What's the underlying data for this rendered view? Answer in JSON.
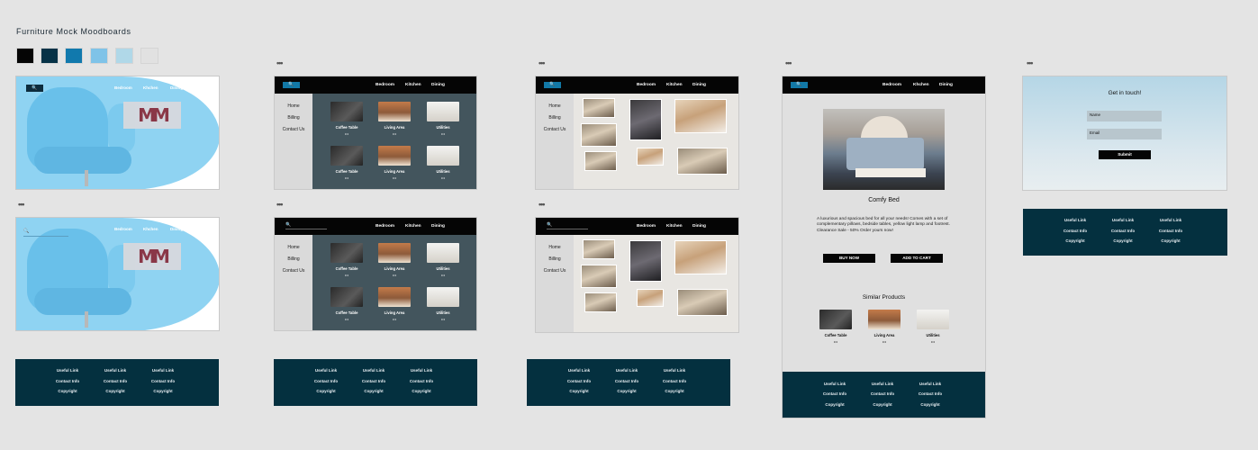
{
  "board_title": "Furniture Mock Moodboards",
  "palette": [
    "#050505",
    "#063247",
    "#1179ad",
    "#7fc3e8",
    "#b0d8e8",
    "#e1e1e1"
  ],
  "dots": "•••",
  "nav": {
    "search": "🔍",
    "bedroom": "Bedroom",
    "kitchen": "Khchen",
    "kitchen_alt": "Kitchen",
    "dining": "Dining"
  },
  "sidebar": {
    "home": "Home",
    "billing": "Billing",
    "contact": "Contact Us"
  },
  "tiles": {
    "coffee": "Coffee Table",
    "living": "Living Area",
    "utilities": "Utilities",
    "dots": "•••"
  },
  "footer": {
    "useful": "Useful Link",
    "contact": "Contact Info",
    "copyright": "Copyright"
  },
  "product": {
    "name": "Comfy Bed",
    "description": "A luxurious and spacious bed for all your needs! Comes with a set of complementary pillows, bedside tables, yellow light lamp and footrest. Clearance Sale - 50% Order yours now!",
    "buy": "BUY NOW",
    "cart": "ADD TO CART",
    "similar": "Similar Products",
    "sim_items": [
      "Coffee Table",
      "Living Area",
      "Utilities"
    ]
  },
  "contact_form": {
    "heading": "Get in touch!",
    "name": "Name",
    "email": "Email",
    "submit": "Submit"
  }
}
